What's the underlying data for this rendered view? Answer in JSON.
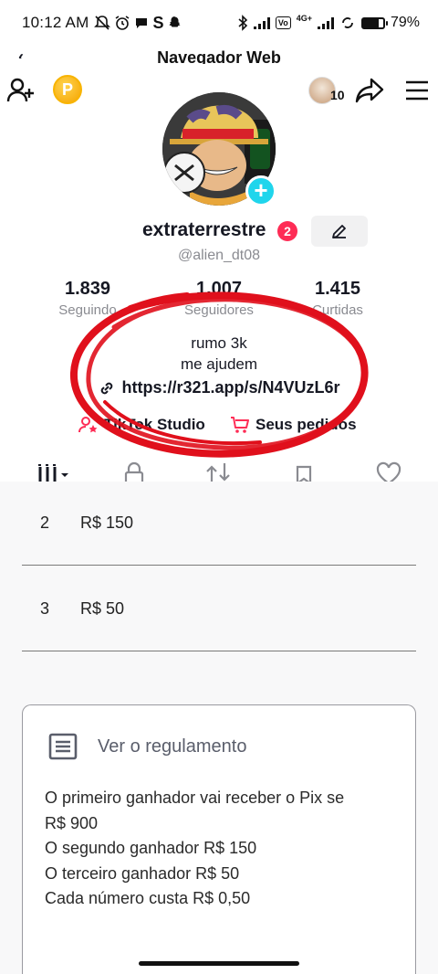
{
  "status_bar": {
    "time": "10:12 AM",
    "network": "4G+",
    "battery": "79%",
    "battery_level": 0.79,
    "icons": [
      "mute-icon",
      "alarm-icon",
      "chat-bubble-icon",
      "s-app-icon",
      "snapchat-icon",
      "bluetooth-icon",
      "signal-icon",
      "volte-icon",
      "sync-icon"
    ]
  },
  "browser": {
    "title": "Navegador Web"
  },
  "profile": {
    "notifications_count": "10",
    "coin_letter": "P",
    "username": "extraterrestre",
    "username_badge": "2",
    "handle": "@alien_dt08",
    "stats": [
      {
        "number": "1.839",
        "label": "Seguindo"
      },
      {
        "number": "1.007",
        "label": "Seguidores"
      },
      {
        "number": "1.415",
        "label": "Curtidas"
      }
    ],
    "bio_line1": "rumo 3k",
    "bio_line2": "me ajudem",
    "link": "https://r321.app/s/N4VUzL6r",
    "shortcuts": [
      {
        "label": "TikTok Studio",
        "icon": "person-star-icon"
      },
      {
        "label": "Seus pedidos",
        "icon": "cart-icon"
      }
    ],
    "tab_icons": [
      "grid-icon",
      "lock-icon",
      "repost-icon",
      "bookmark-icon",
      "heart-icon"
    ],
    "annotation_color": "#e0101c"
  },
  "webview": {
    "prizes": [
      {
        "position": "2",
        "value": "R$ 150"
      },
      {
        "position": "3",
        "value": "R$ 50"
      }
    ],
    "rules_title": "Ver o regulamento",
    "rules_lines": [
      "O primeiro ganhador vai receber o Pix se",
      "R$ 900",
      "O segundo ganhador R$ 150",
      "O terceiro ganhador R$ 50",
      "Cada número custa R$ 0,50"
    ]
  },
  "colors": {
    "accent_cyan": "#20d5ec",
    "badge_red": "#fe2c55",
    "coin_gold": "#f5a400",
    "cart_red": "#fe2c55"
  }
}
